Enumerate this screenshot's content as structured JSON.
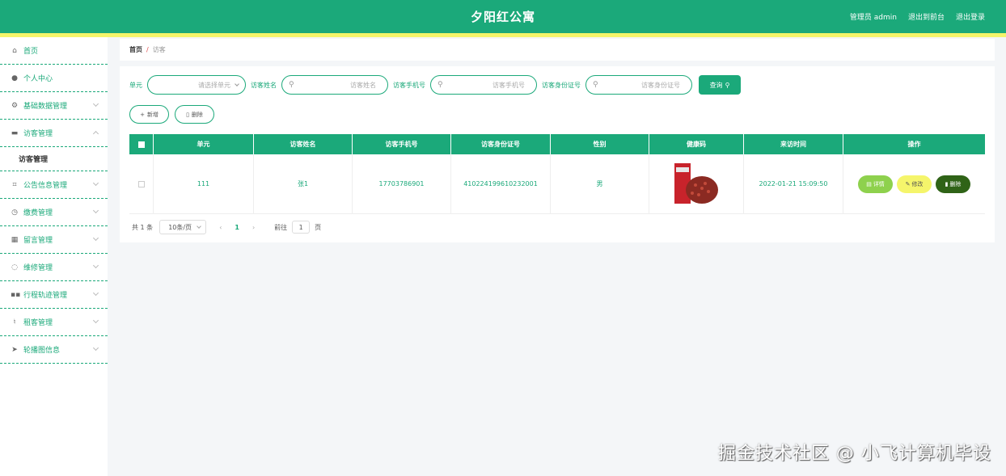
{
  "header": {
    "title": "夕阳红公寓",
    "user_label": "管理员 admin",
    "exit_front": "退出到前台",
    "logout": "退出登录"
  },
  "sidebar": {
    "items": [
      {
        "label": "首页",
        "icon": "home-icon"
      },
      {
        "label": "个人中心",
        "icon": "user-icon"
      },
      {
        "label": "基础数据管理",
        "icon": "settings-icon"
      },
      {
        "label": "访客管理",
        "icon": "list-icon"
      },
      {
        "label": "访客管理",
        "icon": ""
      },
      {
        "label": "公告信息管理",
        "icon": "crop-icon"
      },
      {
        "label": "缴费管理",
        "icon": "clock-icon"
      },
      {
        "label": "留言管理",
        "icon": "calendar-icon"
      },
      {
        "label": "维修管理",
        "icon": "power-icon"
      },
      {
        "label": "行程轨迹管理",
        "icon": "grid-icon"
      },
      {
        "label": "租客管理",
        "icon": "bell-icon"
      },
      {
        "label": "轮播图信息",
        "icon": "send-icon"
      }
    ]
  },
  "breadcrumb": {
    "home": "首页",
    "sep": "/",
    "current": "访客"
  },
  "filters": {
    "unit_label": "单元",
    "unit_placeholder": "请选择单元",
    "name_label": "访客姓名",
    "name_placeholder": "访客姓名",
    "phone_label": "访客手机号",
    "phone_placeholder": "访客手机号",
    "id_label": "访客身份证号",
    "id_placeholder": "访客身份证号",
    "query_button": "查询"
  },
  "actions": {
    "add": "新增",
    "delete": "删除"
  },
  "table": {
    "headers": [
      "单元",
      "访客姓名",
      "访客手机号",
      "访客身份证号",
      "性别",
      "健康码",
      "来访时间",
      "操作"
    ],
    "rows": [
      {
        "unit": "111",
        "name": "张1",
        "phone": "17703786901",
        "id_number": "410224199610232001",
        "gender": "男",
        "visit_time": "2022-01-21 15:09:50",
        "btn_detail": "详情",
        "btn_edit": "修改",
        "btn_delete": "删除"
      }
    ]
  },
  "pager": {
    "total": "共 1 条",
    "page_size": "10条/页",
    "current_page": "1",
    "goto_label": "前往",
    "goto_value": "1",
    "page_suffix": "页"
  },
  "watermark": "掘金技术社区 @ 小飞计算机毕设",
  "colors": {
    "primary": "#1ba97a",
    "stripe": "#f4f56a",
    "detail": "#8ed14d",
    "edit": "#f5f56b",
    "delete": "#2f6317"
  }
}
